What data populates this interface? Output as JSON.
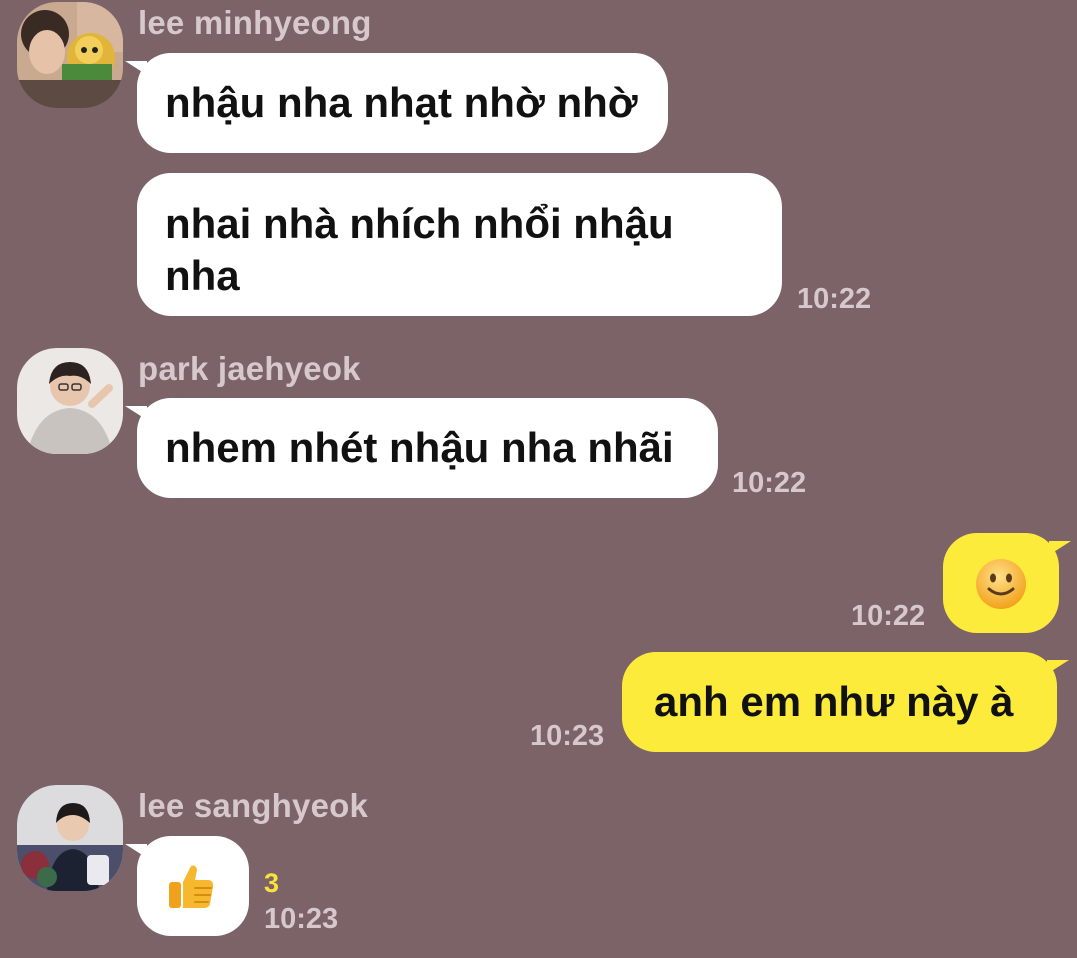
{
  "messages": [
    {
      "sender": "lee minhyeong",
      "bubbles": [
        "nhậu nha nhạt nhờ nhờ",
        "nhai nhà nhích nhổi nhậu nha"
      ],
      "time": "10:22"
    },
    {
      "sender": "park jaehyeok",
      "bubbles": [
        "nhem nhét nhậu nha nhãi"
      ],
      "time": "10:22"
    },
    {
      "sender": "me",
      "emoji": "slightly-smiling-face-emoji",
      "time": "10:22"
    },
    {
      "sender": "me",
      "bubbles": [
        "anh em như này à"
      ],
      "time": "10:23"
    },
    {
      "sender": "lee sanghyeok",
      "emoji": "thumbs-up-emoji",
      "unread_count": "3",
      "time": "10:23"
    }
  ],
  "colors": {
    "background": "#7b6368",
    "incoming_bubble": "#ffffff",
    "outgoing_bubble": "#fdeb3c",
    "meta_text": "#d6c8cb",
    "unread_count": "#f7e33a"
  }
}
